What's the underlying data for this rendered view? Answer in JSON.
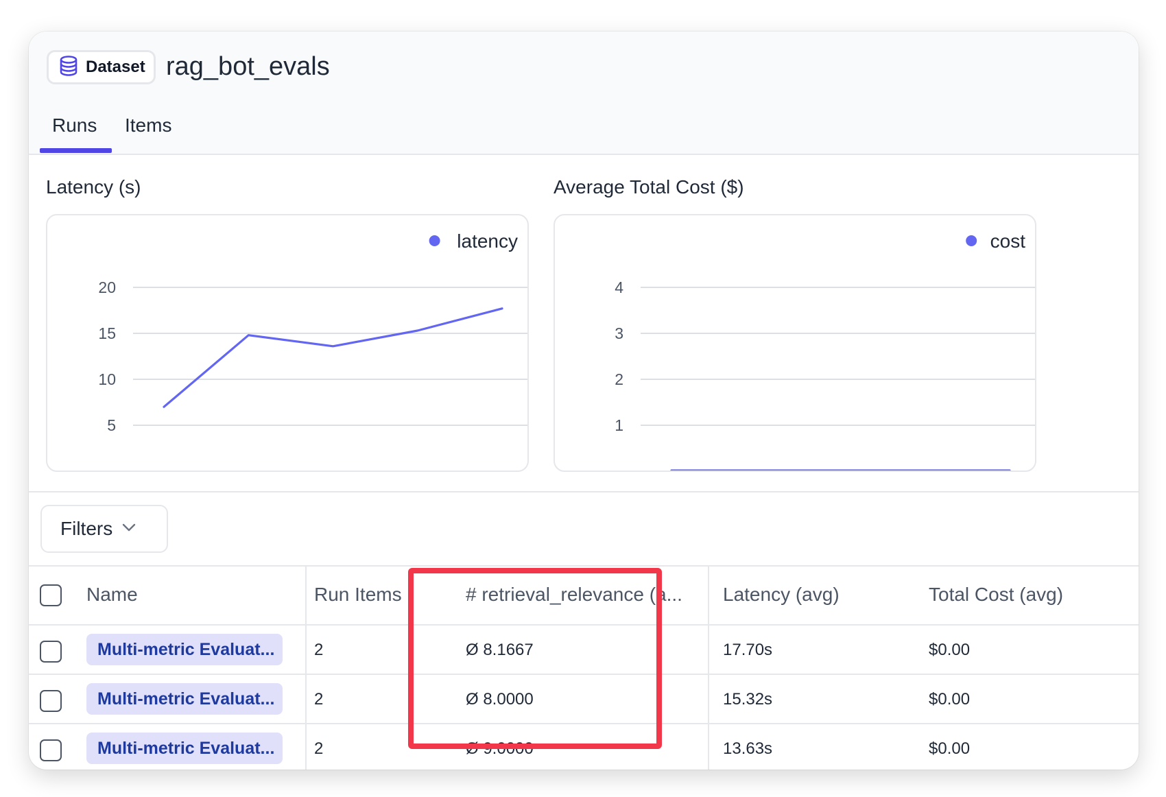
{
  "header": {
    "badge_label": "Dataset",
    "dataset_name": "rag_bot_evals",
    "tabs": [
      {
        "label": "Runs",
        "active": true
      },
      {
        "label": "Items",
        "active": false
      }
    ],
    "accent_color": "#4f46e5"
  },
  "charts": {
    "latency_title": "Latency (s)",
    "cost_title": "Average Total Cost ($)"
  },
  "chart_data": [
    {
      "type": "line",
      "title": "Latency (s)",
      "series": [
        {
          "name": "latency",
          "values": [
            7,
            14.8,
            13.6,
            15.3,
            17.7
          ]
        }
      ],
      "x": [
        1,
        2,
        3,
        4,
        5
      ],
      "yticks": [
        "5",
        "10",
        "15",
        "20"
      ],
      "ylim": [
        0,
        20
      ],
      "grid": true,
      "legend": "top-right",
      "color": "#6366f1"
    },
    {
      "type": "line",
      "title": "Average Total Cost ($)",
      "series": [
        {
          "name": "cost",
          "values": [
            0,
            0,
            0,
            0,
            0
          ]
        }
      ],
      "x": [
        1,
        2,
        3,
        4,
        5
      ],
      "yticks": [
        "1",
        "2",
        "3",
        "4"
      ],
      "ylim": [
        0,
        4
      ],
      "grid": true,
      "legend": "top-right",
      "color": "#6366f1"
    }
  ],
  "filters": {
    "label": "Filters"
  },
  "table": {
    "columns": [
      "Name",
      "Run Items",
      "# retrieval_relevance (a...",
      "Latency (avg)",
      "Total Cost (avg)"
    ],
    "rows": [
      {
        "name": "Multi-metric Evaluat...",
        "run_items": "2",
        "relevance": "Ø 8.1667",
        "latency": "17.70s",
        "cost": "$0.00"
      },
      {
        "name": "Multi-metric Evaluat...",
        "run_items": "2",
        "relevance": "Ø 8.0000",
        "latency": "15.32s",
        "cost": "$0.00"
      },
      {
        "name": "Multi-metric Evaluat...",
        "run_items": "2",
        "relevance": "Ø 9.0000",
        "latency": "13.63s",
        "cost": "$0.00"
      }
    ]
  },
  "highlight_color": "#f2374a"
}
